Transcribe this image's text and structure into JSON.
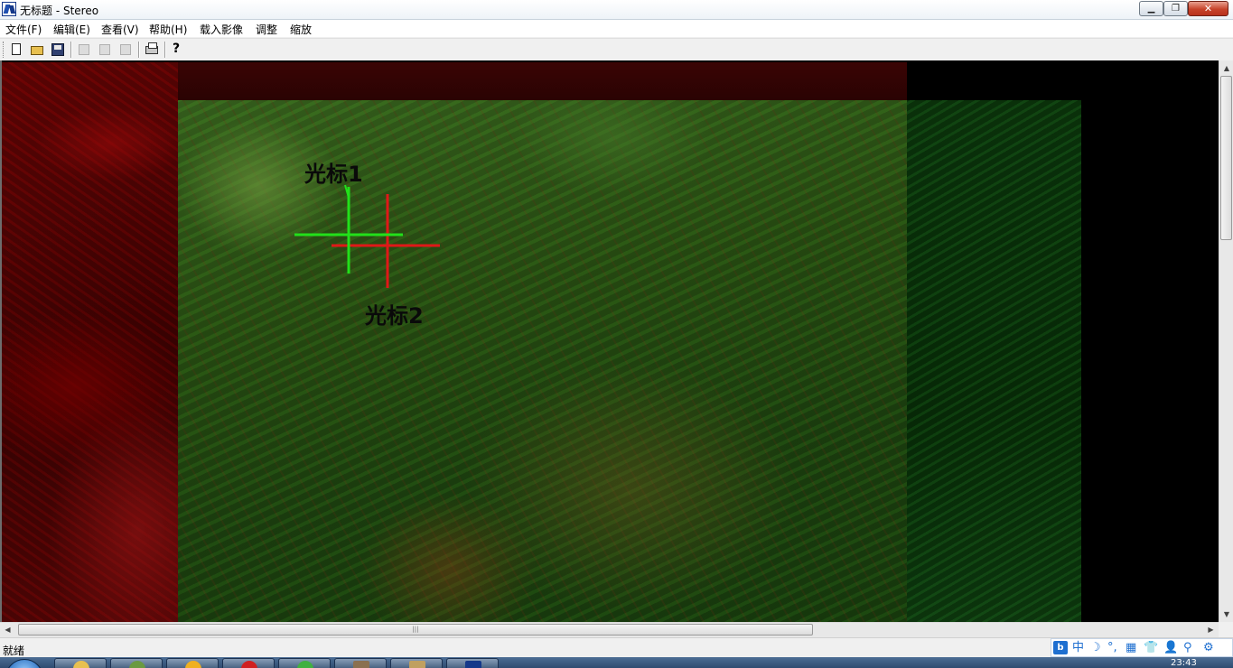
{
  "window": {
    "title": "无标题 - Stereo",
    "controls": {
      "minimize": "▁",
      "maximize": "❐",
      "close": "✕"
    }
  },
  "menu": {
    "items": [
      "文件(F)",
      "编辑(E)",
      "查看(V)",
      "帮助(H)",
      "载入影像",
      "调整",
      "缩放"
    ]
  },
  "toolbar": {
    "buttons": [
      {
        "name": "new-file",
        "icon": "new-file-icon",
        "enabled": true
      },
      {
        "name": "open",
        "icon": "folder-open-icon",
        "enabled": true
      },
      {
        "name": "save",
        "icon": "floppy-save-icon",
        "enabled": true
      },
      {
        "name": "cut",
        "icon": "scissors-cut-icon",
        "enabled": false
      },
      {
        "name": "copy",
        "icon": "copy-icon",
        "enabled": false
      },
      {
        "name": "paste",
        "icon": "paste-icon",
        "enabled": false
      },
      {
        "name": "print",
        "icon": "printer-icon",
        "enabled": true
      },
      {
        "name": "about",
        "icon": "help-question-icon",
        "enabled": true,
        "glyph": "?"
      }
    ]
  },
  "view": {
    "cursor1_label": "光标1",
    "cursor2_label": "光标2",
    "cursor1_color": "#22e01a",
    "cursor2_color": "#e01818",
    "left_image_tint": "#5c0808",
    "right_image_tint": "#2c5014"
  },
  "scrollbars": {
    "vertical": {
      "up": "▲",
      "down": "▼"
    },
    "horizontal": {
      "left": "◀",
      "right": "▶",
      "grip": "|||"
    }
  },
  "status": {
    "text": "就绪"
  },
  "ime": {
    "logo": "b",
    "mode": "中",
    "glyphs": [
      "☽",
      "°,",
      "▦",
      "👕",
      "👤",
      "⚲",
      "⚙"
    ]
  },
  "taskbar": {
    "clock": "23:43",
    "accent": "#2f4c70"
  }
}
